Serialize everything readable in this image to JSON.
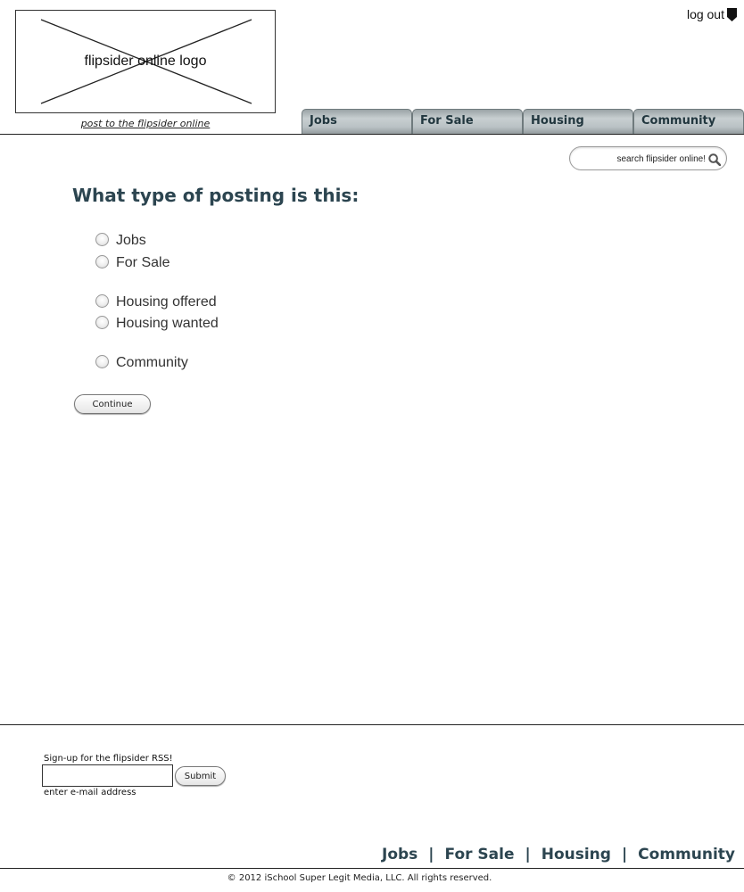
{
  "header": {
    "logo_text": "flipsider online logo",
    "post_link": "post to the flipsider online",
    "logout_label": "log out",
    "nav_tabs": [
      "Jobs",
      "For Sale",
      "Housing",
      "Community"
    ],
    "search": {
      "placeholder": "search flipsider online!"
    }
  },
  "main": {
    "heading": "What type of posting is this:",
    "options": [
      "Jobs",
      "For Sale",
      "Housing offered",
      "Housing wanted",
      "Community"
    ],
    "continue_label": "Continue"
  },
  "footer": {
    "rss_label": "Sign-up for the flipsider RSS!",
    "email_hint": "enter e-mail address",
    "submit_label": "Submit",
    "nav_links": [
      "Jobs",
      "For Sale",
      "Housing",
      "Community"
    ],
    "nav_separator": "|",
    "copyright": "© 2012 iSchool Super Legit Media, LLC. All rights reserved."
  },
  "colors": {
    "accent": "#2c4550",
    "tab_gradient_mid": "#c8cfd1"
  }
}
